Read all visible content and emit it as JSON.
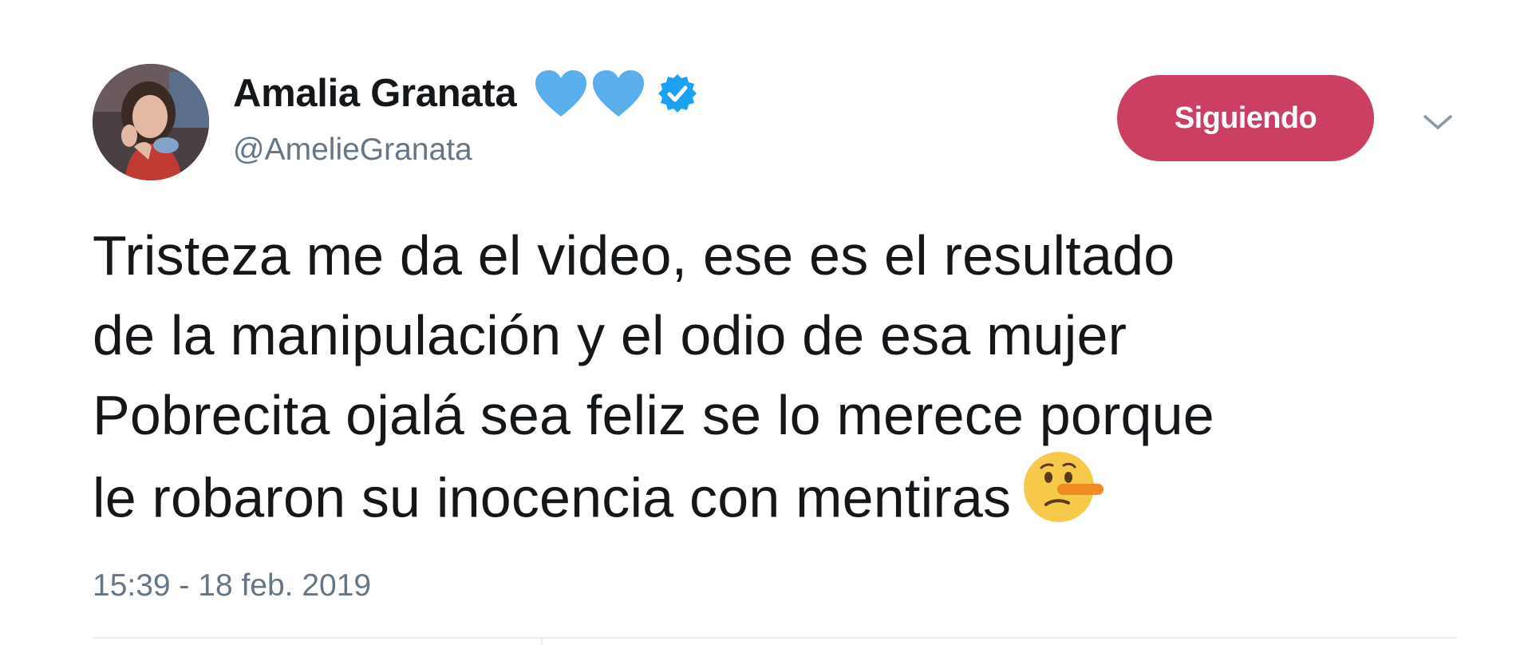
{
  "tweet": {
    "author": {
      "display_name": "Amalia Granata",
      "handle": "@AmelieGranata",
      "name_emojis": [
        "blue-heart-icon",
        "blue-heart-icon"
      ],
      "verified": true,
      "avatar": "profile-photo"
    },
    "follow_button_label": "Siguiendo",
    "menu_icon": "chevron-down-icon",
    "text_lines": [
      "Tristeza me da el video, ese es el resultado",
      "de la manipulación y el odio de esa mujer",
      "Pobrecita ojalá sea feliz se lo merece porque",
      "le robaron su inocencia con mentiras"
    ],
    "trailing_emoji": "lying-face-icon",
    "timestamp": "15:39 - 18 feb. 2019"
  },
  "colors": {
    "follow_button": "#cb3f62",
    "heart": "#5aaeeb",
    "verified_badge": "#1da1f2",
    "secondary_text": "#657786",
    "primary_text": "#14171a",
    "divider": "#e6ecf0"
  }
}
